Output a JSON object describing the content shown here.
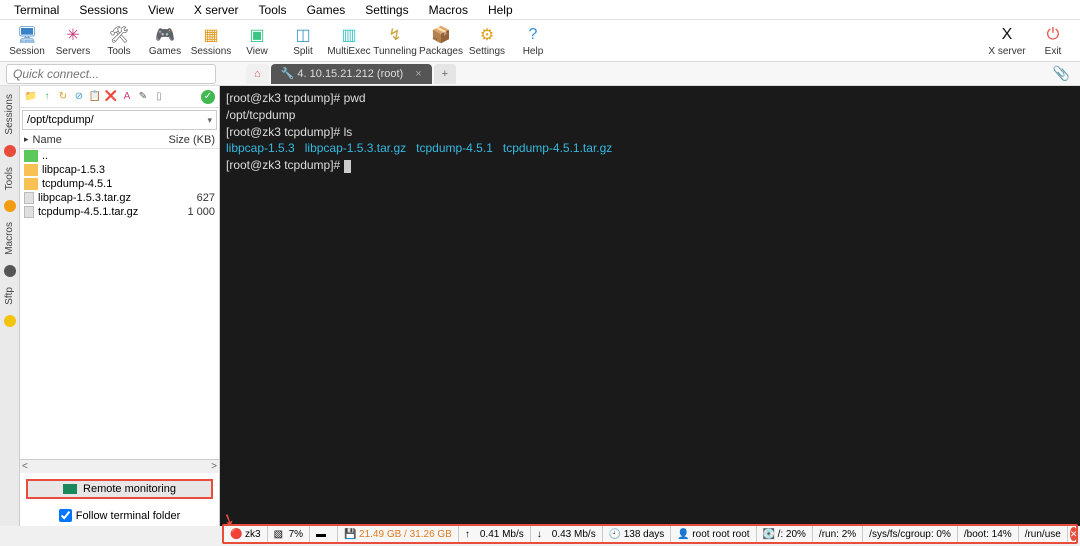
{
  "menu": [
    "Terminal",
    "Sessions",
    "View",
    "X server",
    "Tools",
    "Games",
    "Settings",
    "Macros",
    "Help"
  ],
  "toolbar": [
    {
      "label": "Session",
      "icon": "🖥",
      "color": "#3b83c7"
    },
    {
      "label": "Servers",
      "icon": "✳",
      "color": "#c73b83"
    },
    {
      "label": "Tools",
      "icon": "🛠",
      "color": "#555"
    },
    {
      "label": "Games",
      "icon": "🎮",
      "color": "#444"
    },
    {
      "label": "Sessions",
      "icon": "▦",
      "color": "#e09b1f"
    },
    {
      "label": "View",
      "icon": "▣",
      "color": "#3bc783"
    },
    {
      "label": "Split",
      "icon": "◫",
      "color": "#3b9bc7"
    },
    {
      "label": "MultiExec",
      "icon": "▥",
      "color": "#3bc7c7"
    },
    {
      "label": "Tunneling",
      "icon": "↯",
      "color": "#c7a53b"
    },
    {
      "label": "Packages",
      "icon": "📦",
      "color": "#a85a2a"
    },
    {
      "label": "Settings",
      "icon": "⚙",
      "color": "#e0a020"
    },
    {
      "label": "Help",
      "icon": "?",
      "color": "#2a8be0"
    }
  ],
  "toolbar_right": [
    {
      "label": "X server",
      "icon": "X",
      "color": "#111"
    },
    {
      "label": "Exit",
      "icon": "⏻",
      "color": "#e74c3c"
    }
  ],
  "quick_connect_placeholder": "Quick connect...",
  "tabs": {
    "home_icon": "⌂",
    "active": {
      "title": "4. 10.15.21.212 (root)",
      "icon": "🔧"
    },
    "plus": "+"
  },
  "side_tabs": [
    "Sessions",
    "Tools",
    "Macros",
    "Sftp"
  ],
  "sidebar": {
    "toolbar_icons": [
      "📁",
      "↑",
      "↻",
      "⊘",
      "📋",
      "❌",
      "A",
      "✎",
      "▯"
    ],
    "check": "✓",
    "path": "/opt/tcpdump/",
    "header": {
      "name": "Name",
      "size": "Size (KB)"
    },
    "files": [
      {
        "type": "up",
        "name": ".."
      },
      {
        "type": "dir",
        "name": "libpcap-1.5.3"
      },
      {
        "type": "dir",
        "name": "tcpdump-4.5.1"
      },
      {
        "type": "file",
        "name": "libpcap-1.5.3.tar.gz",
        "size": "627"
      },
      {
        "type": "file",
        "name": "tcpdump-4.5.1.tar.gz",
        "size": "1 000"
      }
    ],
    "remote_monitoring": "Remote monitoring",
    "follow": "Follow terminal folder"
  },
  "terminal_lines": [
    {
      "segments": [
        {
          "t": "[root@zk3 tcpdump]# pwd",
          "c": "w"
        }
      ]
    },
    {
      "segments": [
        {
          "t": "/opt/tcpdump",
          "c": "w"
        }
      ]
    },
    {
      "segments": [
        {
          "t": "[root@zk3 tcpdump]# ls",
          "c": "w"
        }
      ]
    },
    {
      "segments": [
        {
          "t": "libpcap-1.5.3",
          "c": "c"
        },
        {
          "t": "   ",
          "c": "w"
        },
        {
          "t": "libpcap-1.5.3.tar.gz",
          "c": "c"
        },
        {
          "t": "   ",
          "c": "w"
        },
        {
          "t": "tcpdump-4.5.1",
          "c": "c"
        },
        {
          "t": "   ",
          "c": "w"
        },
        {
          "t": "tcpdump-4.5.1.tar.gz",
          "c": "c"
        }
      ]
    },
    {
      "segments": [
        {
          "t": "[root@zk3 tcpdump]# ",
          "c": "w"
        }
      ],
      "cursor": true
    }
  ],
  "status": [
    {
      "icon": "🔴",
      "text": "zk3"
    },
    {
      "icon": "▧",
      "text": "7%"
    },
    {
      "icon": "▬",
      "text": ""
    },
    {
      "icon": "💾",
      "text": "21.49 GB / 31.26 GB",
      "color": "#e07a1f"
    },
    {
      "icon": "↑",
      "text": "0.41 Mb/s"
    },
    {
      "icon": "↓",
      "text": "0.43 Mb/s"
    },
    {
      "icon": "🕘",
      "text": "138 days"
    },
    {
      "icon": "👤",
      "text": "root root root"
    },
    {
      "icon": "💽",
      "text": "/: 20%"
    },
    {
      "text": "/run: 2%"
    },
    {
      "text": "/sys/fs/cgroup: 0%"
    },
    {
      "text": "/boot: 14%"
    },
    {
      "text": "/run/use"
    }
  ]
}
